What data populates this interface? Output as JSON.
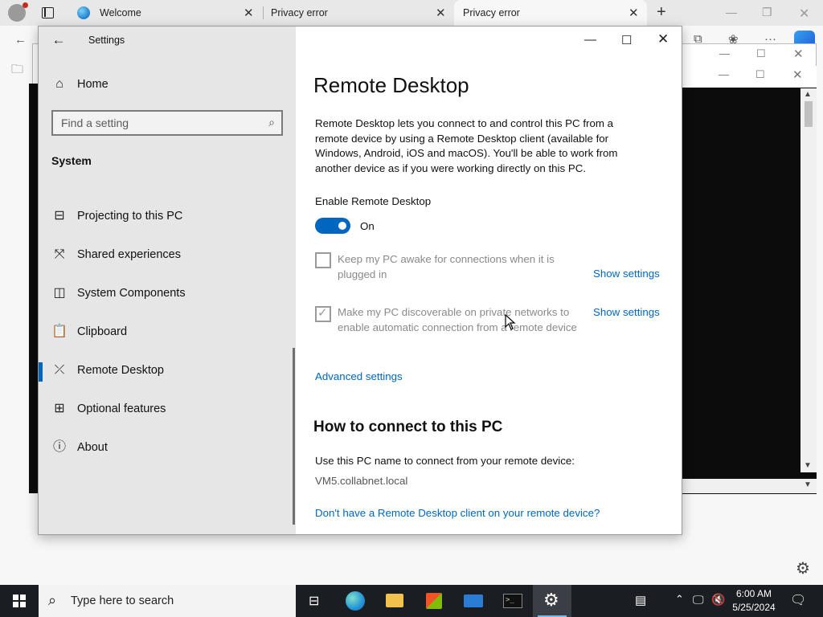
{
  "browser": {
    "tabs": [
      {
        "title": "Welcome"
      },
      {
        "title": "Privacy error"
      },
      {
        "title": "Privacy error"
      }
    ]
  },
  "settings": {
    "app_title": "Settings",
    "search": {
      "placeholder": "Find a setting"
    },
    "nav_home": "Home",
    "section": "System",
    "nav_items": [
      {
        "label": "Projecting to this PC",
        "icon": "projecting-icon"
      },
      {
        "label": "Shared experiences",
        "icon": "shared-experiences-icon"
      },
      {
        "label": "System Components",
        "icon": "system-components-icon"
      },
      {
        "label": "Clipboard",
        "icon": "clipboard-icon"
      },
      {
        "label": "Remote Desktop",
        "icon": "remote-desktop-icon",
        "selected": true
      },
      {
        "label": "Optional features",
        "icon": "optional-features-icon"
      },
      {
        "label": "About",
        "icon": "info-icon"
      }
    ],
    "page": {
      "title": "Remote Desktop",
      "description": "Remote Desktop lets you connect to and control this PC from a remote device by using a Remote Desktop client (available for Windows, Android, iOS and macOS). You'll be able to work from another device as if you were working directly on this PC.",
      "enable_label": "Enable Remote Desktop",
      "toggle_state": "On",
      "keep_awake_label": "Keep my PC awake for connections when it is plugged in",
      "keep_awake_checked": false,
      "discoverable_label": "Make my PC discoverable on private networks to enable automatic connection from a remote device",
      "discoverable_checked": true,
      "show_settings_1": "Show settings",
      "show_settings_2": "Show settings",
      "advanced_settings": "Advanced settings",
      "how_to_heading": "How to connect to this PC",
      "pc_name_label": "Use this PC name to connect from your remote device:",
      "pc_name": "VM5.collabnet.local",
      "no_client_link": "Don't have a Remote Desktop client on your remote device?"
    }
  },
  "taskbar": {
    "search_placeholder": "Type here to search",
    "time": "6:00 AM",
    "date": "5/25/2024",
    "accent_color": "#0067c0"
  }
}
